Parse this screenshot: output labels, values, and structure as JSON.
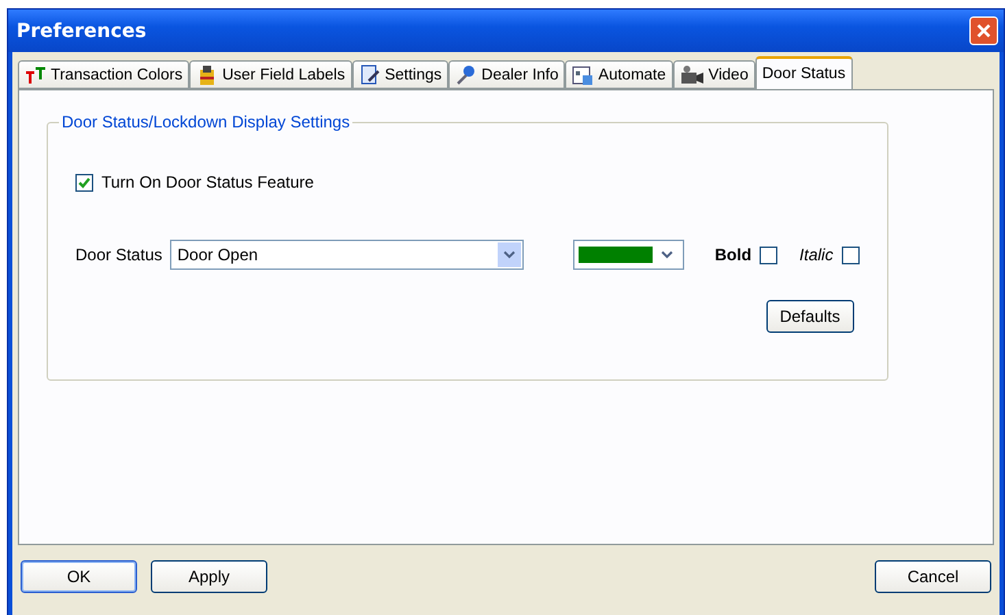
{
  "window": {
    "title": "Preferences"
  },
  "tabs": [
    {
      "label": "Transaction Colors",
      "kind": "text",
      "selected": false
    },
    {
      "label": "User Field Labels",
      "kind": "bag",
      "selected": false
    },
    {
      "label": "Settings",
      "kind": "doc",
      "selected": false
    },
    {
      "label": "Dealer Info",
      "kind": "pin",
      "selected": false
    },
    {
      "label": "Automate",
      "kind": "cal",
      "selected": false
    },
    {
      "label": "Video",
      "kind": "cam",
      "selected": false
    },
    {
      "label": "Door Status",
      "selected": true
    }
  ],
  "group": {
    "title": "Door Status/Lockdown Display Settings",
    "feature": {
      "label": "Turn On Door Status Feature",
      "checked": true
    },
    "door_status": {
      "label": "Door Status",
      "value": "Door Open",
      "color": "#008000"
    },
    "bold": {
      "label": "Bold",
      "checked": false
    },
    "italic": {
      "label": "Italic",
      "checked": false
    },
    "defaults_button": "Defaults"
  },
  "buttons": [
    {
      "label": "OK",
      "kind": "default"
    },
    {
      "label": "Apply",
      "kind": "normal"
    },
    {
      "label": "Cancel",
      "kind": "cancel"
    }
  ]
}
